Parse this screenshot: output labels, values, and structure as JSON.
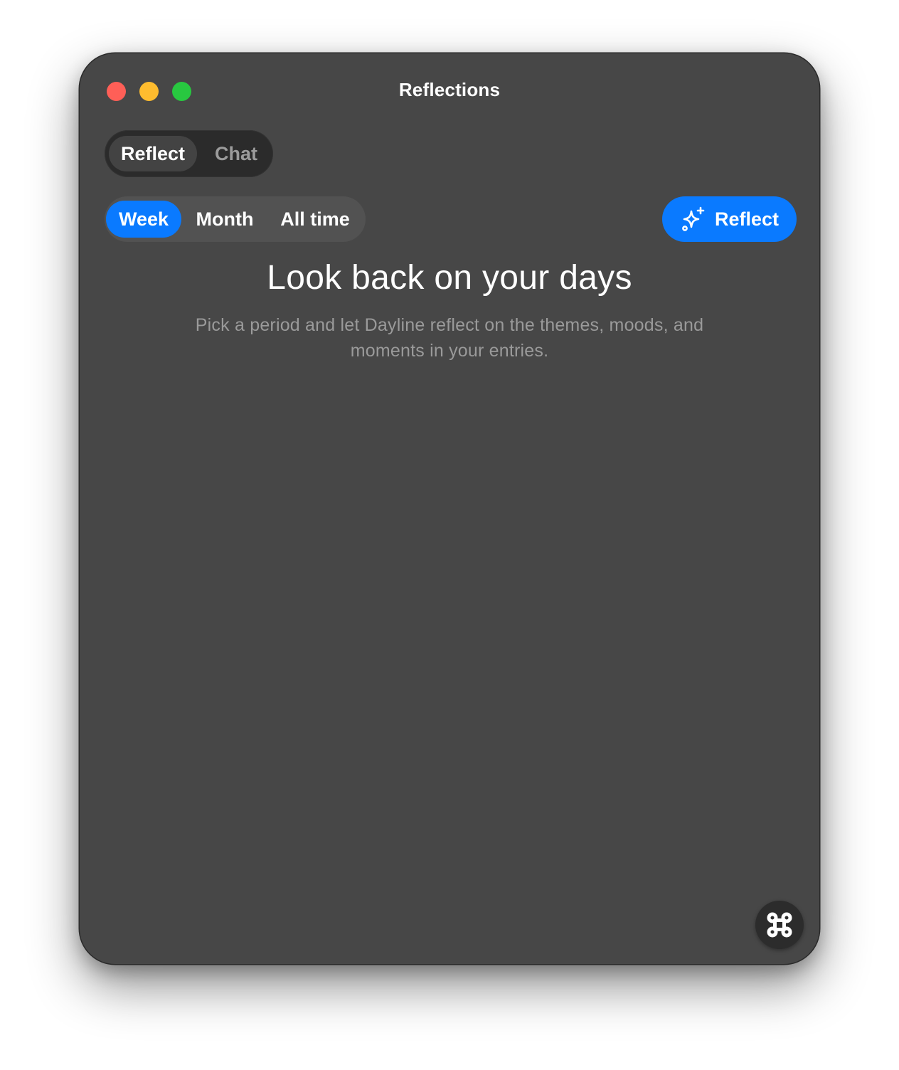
{
  "window": {
    "title": "Reflections"
  },
  "mode_tabs": [
    {
      "label": "Reflect",
      "active": true
    },
    {
      "label": "Chat",
      "active": false
    }
  ],
  "period_tabs": [
    {
      "label": "Week",
      "active": true
    },
    {
      "label": "Month",
      "active": false
    },
    {
      "label": "All time",
      "active": false
    }
  ],
  "reflect_button": {
    "label": "Reflect",
    "icon": "sparkles-icon"
  },
  "empty_state": {
    "heading": "Look back on your days",
    "subtitle": "Pick a period and let Dayline reflect on the themes, moods, and moments in your entries."
  },
  "fab": {
    "icon": "command-icon"
  },
  "colors": {
    "accent": "#0a7aff",
    "window_bg": "#474747",
    "close": "#ff5f57",
    "minimize": "#febc2e",
    "maximize": "#28c840"
  }
}
